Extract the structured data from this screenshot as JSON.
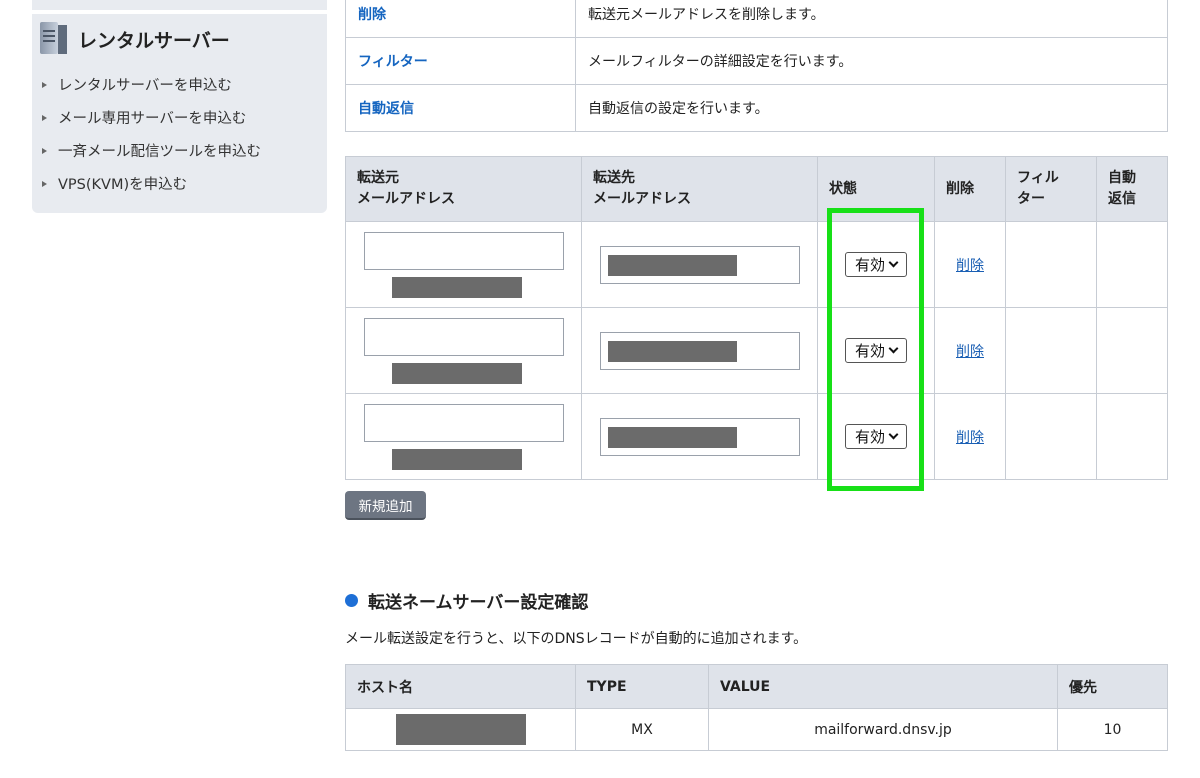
{
  "sidebar": {
    "title": "レンタルサーバー",
    "items": [
      {
        "label": "レンタルサーバーを申込む"
      },
      {
        "label": "メール専用サーバーを申込む"
      },
      {
        "label": "一斉メール配信ツールを申込む"
      },
      {
        "label": "VPS(KVM)を申込む"
      }
    ]
  },
  "ops_table": [
    {
      "key": "削除",
      "desc": "転送元メールアドレスを削除します。"
    },
    {
      "key": "フィルター",
      "desc": "メールフィルターの詳細設定を行います。"
    },
    {
      "key": "自動返信",
      "desc": "自動返信の設定を行います。"
    }
  ],
  "forward_table": {
    "headers": {
      "src_line1": "転送元",
      "src_line2": "メールアドレス",
      "dst_line1": "転送先",
      "dst_line2": "メールアドレス",
      "status": "状態",
      "delete": "削除",
      "filter_line1": "フィル",
      "filter_line2": "ター",
      "auto_line1": "自動",
      "auto_line2": "返信"
    },
    "rows": [
      {
        "status": "有効",
        "delete_label": "削除"
      },
      {
        "status": "有効",
        "delete_label": "削除"
      },
      {
        "status": "有効",
        "delete_label": "削除"
      }
    ]
  },
  "add_button": "新規追加",
  "dns_section": {
    "title": "転送ネームサーバー設定確認",
    "description": "メール転送設定を行うと、以下のDNSレコードが自動的に追加されます。",
    "headers": {
      "host": "ホスト名",
      "type": "TYPE",
      "value": "VALUE",
      "priority": "優先"
    },
    "row": {
      "type": "MX",
      "value": "mailforward.dnsv.jp",
      "priority": "10"
    }
  },
  "colors": {
    "highlight": "#17e017",
    "link": "#1a5fb4",
    "bullet": "#1e6fd6",
    "header_bg": "#dfe3ea"
  }
}
